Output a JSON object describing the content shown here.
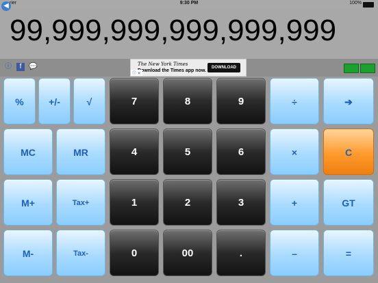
{
  "status_bar": {
    "carrier": "rier",
    "time": "9:30 PM",
    "battery": "100%"
  },
  "display": {
    "value": "99,999,999,999,999,999"
  },
  "ad": {
    "brand": "The New York Times",
    "tagline": "Download the Times app now.",
    "button": "DOWNLOAD",
    "adchoices": "ⓘ ✕"
  },
  "keys": {
    "percent": "%",
    "plus_minus": "+/-",
    "sqrt": "√",
    "seven": "7",
    "eight": "8",
    "nine": "9",
    "divide": "÷",
    "backspace": "➔",
    "mc": "MC",
    "mr": "MR",
    "four": "4",
    "five": "5",
    "six": "6",
    "multiply": "×",
    "clear": "C",
    "m_plus": "M+",
    "tax_plus": "Tax+",
    "one": "1",
    "two": "2",
    "three": "3",
    "add": "+",
    "gt": "GT",
    "m_minus": "M-",
    "tax_minus": "Tax-",
    "zero": "0",
    "double_zero": "00",
    "dot": ".",
    "subtract": "–",
    "equals": "="
  },
  "colors": {
    "blue_key": "#a9dbff",
    "dark_key": "#2a2a2a",
    "clear_key": "#ff9a2c",
    "text_blue": "#1d5fbf"
  }
}
